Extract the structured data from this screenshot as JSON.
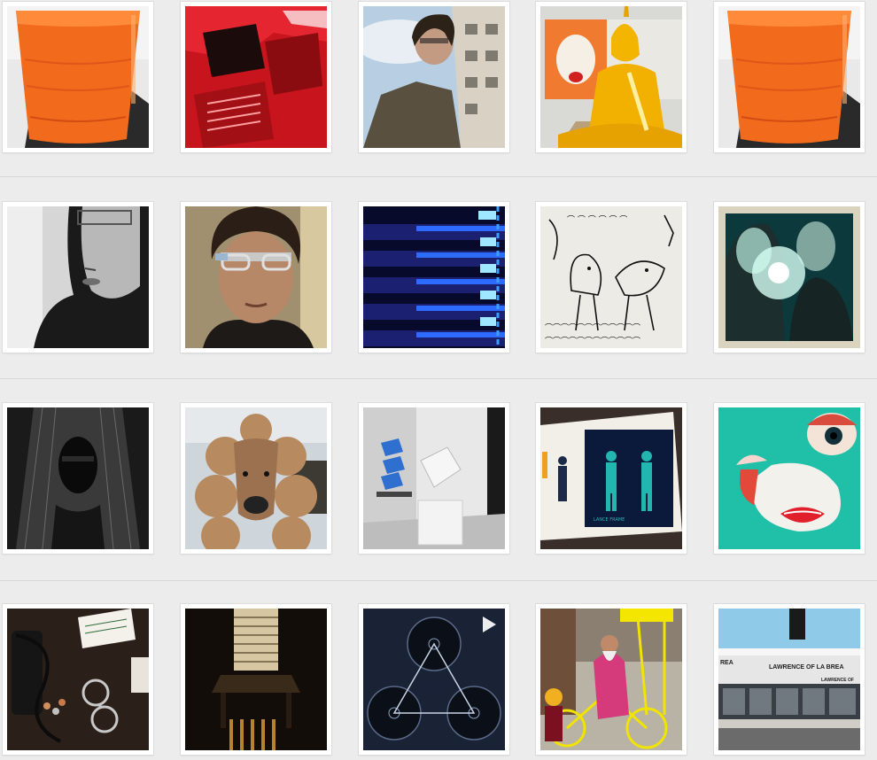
{
  "gallery": {
    "photos": [
      {
        "subject": "carrot-juice-glass"
      },
      {
        "subject": "red-staircase-building"
      },
      {
        "subject": "selfie-low-angle"
      },
      {
        "subject": "golden-buddha-statue"
      },
      {
        "subject": "carrot-juice-glass"
      },
      {
        "subject": "bw-profile-portrait"
      },
      {
        "subject": "selfie-with-glasses"
      },
      {
        "subject": "blue-lit-piano-keys"
      },
      {
        "subject": "bird-line-drawings"
      },
      {
        "subject": "two-men-teal-flare"
      },
      {
        "subject": "dark-hair-sculpture"
      },
      {
        "subject": "poodle-sculpture"
      },
      {
        "subject": "gallery-sculptures"
      },
      {
        "subject": "teal-figure-print"
      },
      {
        "subject": "egg-eye-lips-art"
      },
      {
        "subject": "desk-glasses-cable"
      },
      {
        "subject": "dark-room-table"
      },
      {
        "subject": "three-circles-video"
      },
      {
        "subject": "parade-bicycle"
      },
      {
        "subject": "street-storefront"
      }
    ],
    "video_indicator": "play-icon",
    "sign_text": {
      "main": "LAWRENCE OF LA BREA",
      "left": "REA",
      "right": "LAWRENCE OF"
    },
    "poster_text": "LANCE FRAME"
  }
}
